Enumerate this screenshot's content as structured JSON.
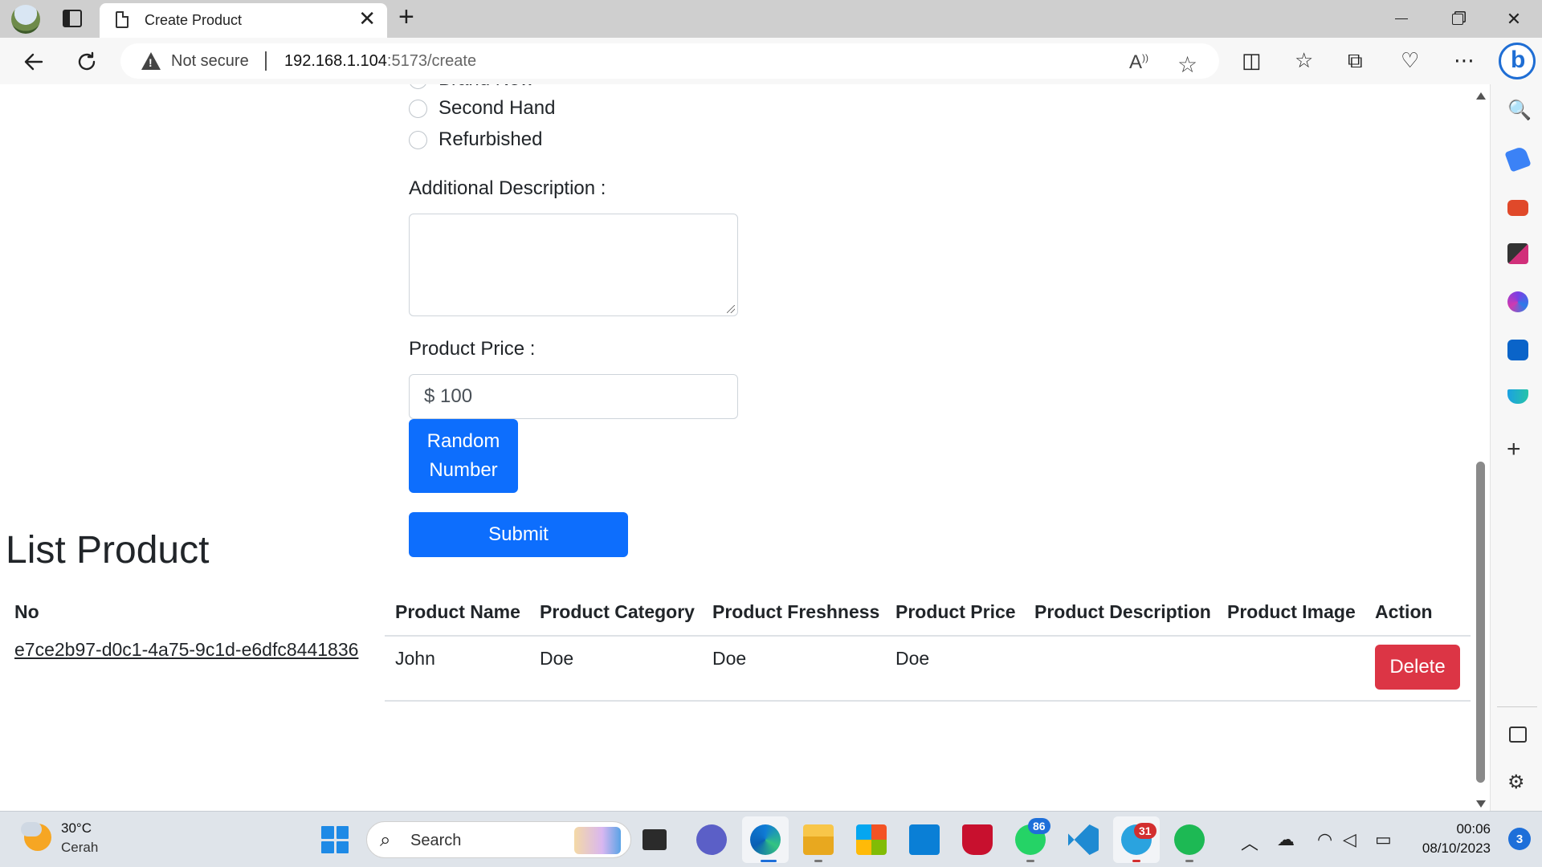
{
  "browser": {
    "tab_title": "Create Product",
    "tab_close": "✕",
    "new_tab": "+",
    "security_label": "Not secure",
    "url_host": "192.168.1.104",
    "url_path": ":5173/create",
    "window_controls": {
      "minimize": "—",
      "restore": "❐",
      "close": "✕"
    }
  },
  "form": {
    "freshness_options": [
      "Brand New",
      "Second Hand",
      "Refurbished"
    ],
    "description_label": "Additional Description :",
    "description_value": "",
    "price_label": "Product Price :",
    "price_value": "$ 100",
    "random_button": "Random Number",
    "submit_button": "Submit"
  },
  "list": {
    "title": "List Product",
    "columns": [
      "No",
      "Product Name",
      "Product Category",
      "Product Freshness",
      "Product Price",
      "Product Description",
      "Product Image",
      "Action"
    ],
    "rows": [
      {
        "id": "e7ce2b97-d0c1-4a75-9c1d-e6dfc8441836",
        "name": "John",
        "category": "Doe",
        "freshness": "Doe",
        "price": "Doe",
        "description": "",
        "image": "",
        "action": "Delete"
      }
    ]
  },
  "taskbar": {
    "weather_temp": "30°C",
    "weather_condition": "Cerah",
    "search_placeholder": "Search",
    "whatsapp_badge": "86",
    "telegram_badge": "31",
    "time": "00:06",
    "date": "08/10/2023",
    "notifications": "3"
  },
  "colors": {
    "primary": "#0d6efd",
    "danger": "#dc3545",
    "chrome_bg": "#cfcfcf",
    "toolbar_bg": "#f7f7f7",
    "taskbar_bg": "#dfe4ea"
  },
  "icons": {
    "toolbar": [
      "back-icon",
      "refresh-icon",
      "read-aloud-icon",
      "favorite-star-icon",
      "split-screen-icon",
      "favorites-icon",
      "collections-icon",
      "browser-essentials-icon",
      "more-icon",
      "copilot-icon"
    ],
    "sidebar": [
      "search-icon",
      "shopping-icon",
      "tools-icon",
      "games-icon",
      "microsoft365-icon",
      "outlook-icon",
      "drop-icon",
      "add-icon",
      "sidebar-toggle-icon",
      "settings-icon"
    ]
  }
}
